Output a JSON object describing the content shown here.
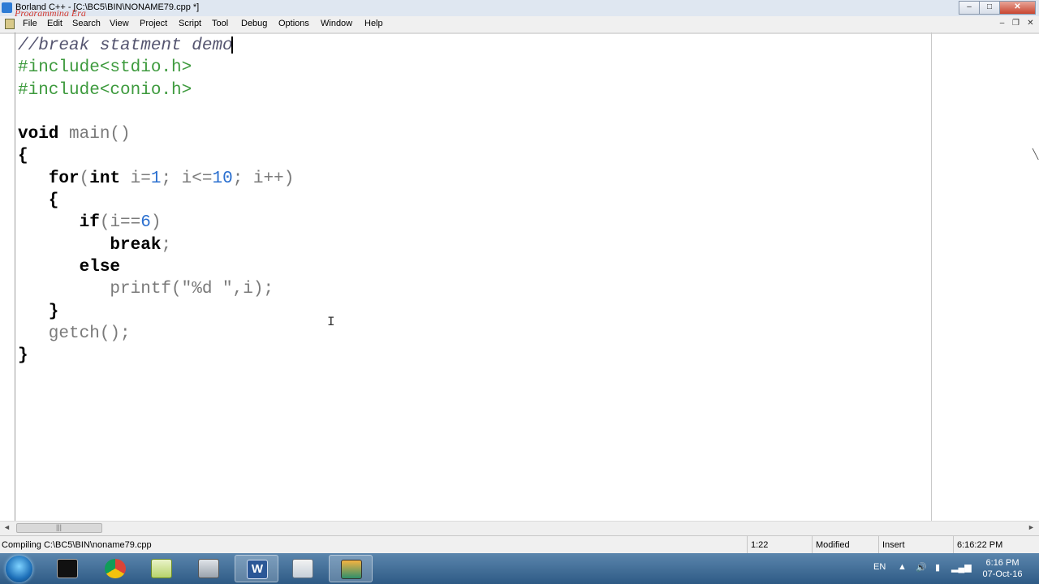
{
  "window": {
    "title": "Borland C++ - [C:\\BC5\\BIN\\NONAME79.cpp *]",
    "watermark": "Programming Era",
    "controls": {
      "minimize": "–",
      "maximize": "□",
      "close": "✕"
    }
  },
  "menu": {
    "items": [
      "File",
      "Edit",
      "Search",
      "View",
      "Project",
      "Script",
      "Tool",
      "Debug",
      "Options",
      "Window",
      "Help"
    ],
    "mdi_controls": {
      "minimize": "–",
      "restore": "❐",
      "close": "✕"
    }
  },
  "editor": {
    "lines": [
      "//break statment demo",
      "#include<stdio.h>",
      "#include<conio.h>",
      "",
      "void main()",
      "{",
      "   for(int i=1; i<=10; i++)",
      "   {",
      "      if(i==6)",
      "         break;",
      "      else",
      "         printf(\"%d \",i);",
      "   }",
      "   getch();",
      "}"
    ],
    "colors": {
      "comment": "#555570",
      "preprocessor": "#3d9a3d",
      "keyword": "#000000",
      "number": "#2a6fcf",
      "default": "#7a7a7a"
    }
  },
  "scrollbar": {
    "left_arrow": "◄",
    "grip": "|||",
    "right_arrow": "►"
  },
  "status": {
    "message": "Compiling C:\\BC5\\BIN\\noname79.cpp",
    "position": "1:22",
    "modified": "Modified",
    "mode": "Insert",
    "time": "6:16:22 PM"
  },
  "taskbar": {
    "apps": [
      {
        "name": "cmd-icon"
      },
      {
        "name": "chrome-icon"
      },
      {
        "name": "notepad-icon"
      },
      {
        "name": "fax-icon"
      },
      {
        "name": "word-icon",
        "glyph": "W"
      },
      {
        "name": "calculator-icon"
      },
      {
        "name": "borland-icon"
      }
    ],
    "tray": {
      "language": "EN",
      "show_hidden": "▲",
      "speaker": "🔊",
      "battery": "▮",
      "network": "▂▄▆",
      "time": "6:16 PM",
      "date": "07-Oct-16"
    }
  }
}
